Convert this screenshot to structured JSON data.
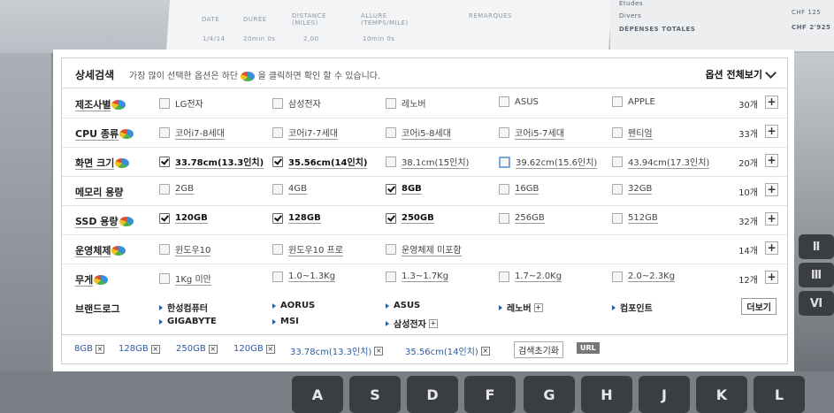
{
  "background": {
    "doc_headers": [
      "DATE",
      "DURÉE",
      "DISTANCE (MILES)",
      "ALLURE (TEMPS/MILE)",
      "REMARQUES"
    ],
    "doc_row": [
      "1/4/14",
      "20min 0s",
      "2,00",
      "10min 0s"
    ],
    "side_lines": [
      "Etudes",
      "Divers",
      "DÉPENSES TOTALES"
    ],
    "side_vals": [
      "CHF 125",
      "CHF 2'925"
    ],
    "keys": [
      "A",
      "S",
      "D",
      "F",
      "G",
      "H",
      "J",
      "K",
      "L"
    ],
    "right_keys": [
      "Ⅱ",
      "Ⅲ",
      "Ⅵ"
    ]
  },
  "header": {
    "title": "상세검색",
    "hint_before": "가장 많이 선택한 옵션은 하단",
    "hint_after": "을 클릭하면 확인 할 수 있습니다.",
    "view_all": "옵션 전체보기"
  },
  "rows": [
    {
      "label": "제조사별",
      "pie": true,
      "count": "30개",
      "options": [
        {
          "text": "LG전자",
          "checked": false,
          "u": false
        },
        {
          "text": "삼성전자",
          "checked": false,
          "u": false
        },
        {
          "text": "레노버",
          "checked": false,
          "u": false
        },
        {
          "text": "ASUS",
          "checked": false,
          "u": false
        },
        {
          "text": "APPLE",
          "checked": false,
          "u": false
        }
      ]
    },
    {
      "label": "CPU 종류",
      "pie": true,
      "count": "33개",
      "options": [
        {
          "text": "코어i7-8세대",
          "checked": false,
          "u": true
        },
        {
          "text": "코어i7-7세대",
          "checked": false,
          "u": true
        },
        {
          "text": "코어i5-8세대",
          "checked": false,
          "u": true
        },
        {
          "text": "코어i5-7세대",
          "checked": false,
          "u": true
        },
        {
          "text": "펜티엄",
          "checked": false,
          "u": true
        }
      ]
    },
    {
      "label": "화면 크기",
      "pie": true,
      "count": "20개",
      "options": [
        {
          "text": "33.78cm(13.3인치)",
          "checked": true,
          "u": true
        },
        {
          "text": "35.56cm(14인치)",
          "checked": true,
          "u": true
        },
        {
          "text": "38.1cm(15인치)",
          "checked": false,
          "u": true
        },
        {
          "text": "39.62cm(15.6인치)",
          "checked": false,
          "u": true,
          "hl": true
        },
        {
          "text": "43.94cm(17.3인치)",
          "checked": false,
          "u": true
        }
      ]
    },
    {
      "label": "메모리 용량",
      "pie": false,
      "count": "10개",
      "options": [
        {
          "text": "2GB",
          "checked": false,
          "u": true
        },
        {
          "text": "4GB",
          "checked": false,
          "u": true
        },
        {
          "text": "8GB",
          "checked": true,
          "u": true
        },
        {
          "text": "16GB",
          "checked": false,
          "u": true
        },
        {
          "text": "32GB",
          "checked": false,
          "u": true
        }
      ]
    },
    {
      "label": "SSD 용량",
      "pie": true,
      "count": "32개",
      "options": [
        {
          "text": "120GB",
          "checked": true,
          "u": true
        },
        {
          "text": "128GB",
          "checked": true,
          "u": true
        },
        {
          "text": "250GB",
          "checked": true,
          "u": true
        },
        {
          "text": "256GB",
          "checked": false,
          "u": true
        },
        {
          "text": "512GB",
          "checked": false,
          "u": true
        }
      ]
    },
    {
      "label": "운영체제",
      "pie": true,
      "count": "14개",
      "options": [
        {
          "text": "윈도우10",
          "checked": false,
          "u": true
        },
        {
          "text": "윈도우10 프로",
          "checked": false,
          "u": true
        },
        {
          "text": "운영체제 미포함",
          "checked": false,
          "u": true
        }
      ]
    },
    {
      "label": "무게",
      "pie": true,
      "count": "12개",
      "options": [
        {
          "text": "1Kg 미만",
          "checked": false,
          "u": true
        },
        {
          "text": "1.0~1.3Kg",
          "checked": false,
          "u": true
        },
        {
          "text": "1.3~1.7Kg",
          "checked": false,
          "u": true
        },
        {
          "text": "1.7~2.0Kg",
          "checked": false,
          "u": true
        },
        {
          "text": "2.0~2.3Kg",
          "checked": false,
          "u": true
        }
      ]
    }
  ],
  "brand": {
    "label": "브랜드로그",
    "items": [
      {
        "text": "한성컴퓨터",
        "plus": false
      },
      {
        "text": "AORUS",
        "plus": false
      },
      {
        "text": "ASUS",
        "plus": false
      },
      {
        "text": "레노버",
        "plus": true
      },
      {
        "text": "컴포인트",
        "plus": false
      },
      {
        "text": "GIGABYTE",
        "plus": false
      },
      {
        "text": "MSI",
        "plus": false
      },
      {
        "text": "삼성전자",
        "plus": true
      }
    ],
    "more": "더보기"
  },
  "selected": {
    "chips": [
      "8GB",
      "128GB",
      "250GB",
      "120GB",
      "33.78cm(13.3인치)",
      "35.56cm(14인치)"
    ],
    "reset": "검색초기화",
    "url": "URL"
  },
  "colors": {
    "link": "#2b5ba5",
    "accent": "#2a5da8"
  }
}
